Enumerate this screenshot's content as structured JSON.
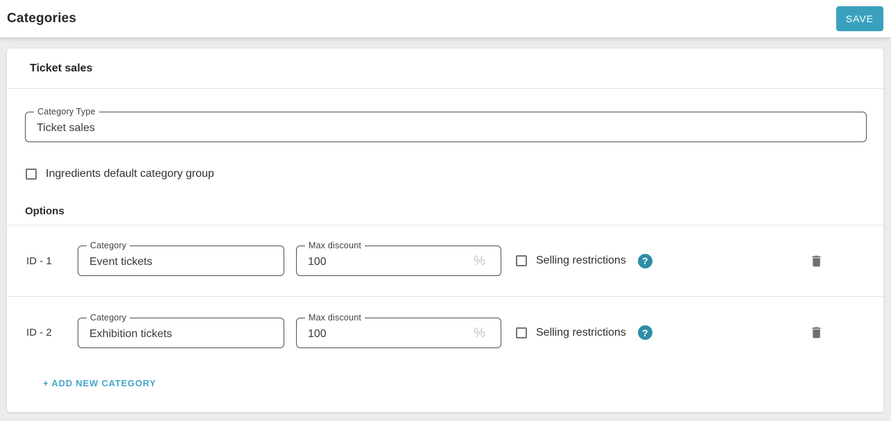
{
  "header": {
    "title": "Categories",
    "save_label": "SAVE"
  },
  "card": {
    "section_title": "Ticket sales",
    "category_type_field": {
      "label": "Category Type",
      "value": "Ticket sales"
    },
    "ingredients_checkbox_label": "Ingredients default category group",
    "options_heading": "Options",
    "rows": [
      {
        "id_label": "ID - 1",
        "category": {
          "label": "Category",
          "value": "Event tickets"
        },
        "max_discount": {
          "label": "Max discount",
          "value": "100",
          "suffix": "%"
        },
        "selling_restrictions_label": "Selling restrictions",
        "help_icon_glyph": "?"
      },
      {
        "id_label": "ID - 2",
        "category": {
          "label": "Category",
          "value": "Exhibition tickets"
        },
        "max_discount": {
          "label": "Max discount",
          "value": "100",
          "suffix": "%"
        },
        "selling_restrictions_label": "Selling restrictions",
        "help_icon_glyph": "?"
      }
    ],
    "add_button_label": "+ ADD NEW CATEGORY"
  },
  "colors": {
    "accent_teal": "#39a1be",
    "help_icon_teal": "#2e8da6",
    "link_blue": "#45a5c9",
    "background_gray": "#ececec"
  }
}
